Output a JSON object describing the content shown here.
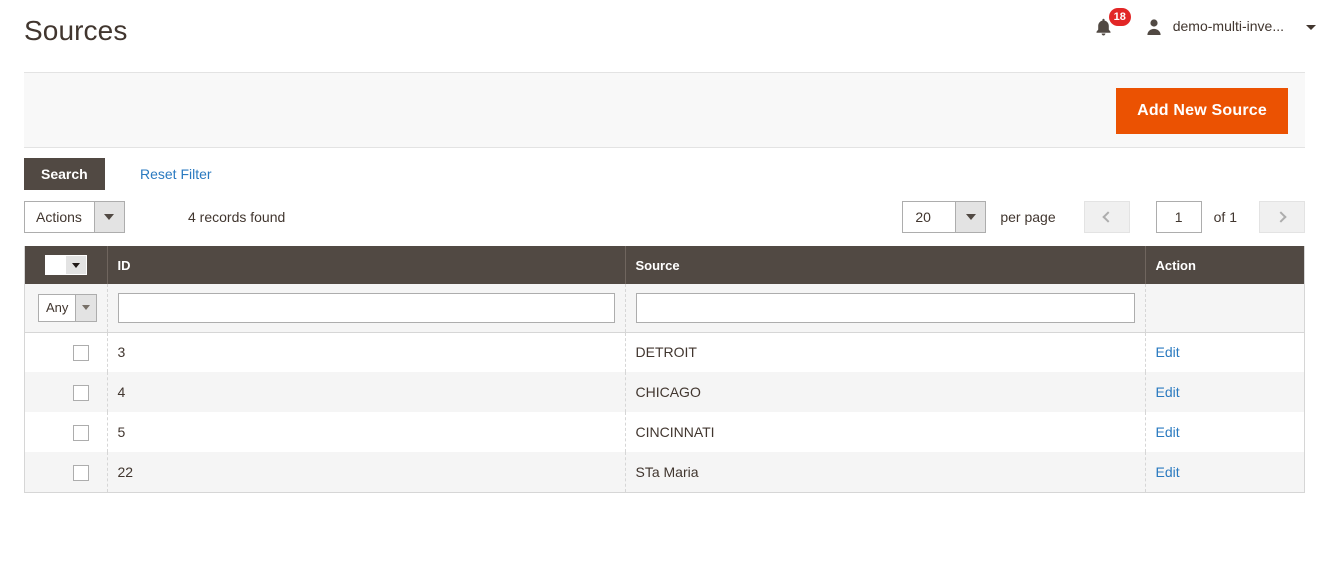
{
  "header": {
    "title": "Sources",
    "notifications": {
      "icon": "bell-icon",
      "count": "18"
    },
    "user": {
      "icon": "user-icon",
      "name": "demo-multi-inve...",
      "caret": "chevron-down-icon"
    }
  },
  "page_actions": {
    "add_new_source": "Add New Source",
    "accent_color": "#eb5202"
  },
  "grid_toolbar": {
    "search_button": "Search",
    "reset_filter": "Reset Filter",
    "actions_label": "Actions",
    "records_found": "4 records found",
    "per_page_value": "20",
    "per_page_label": "per page",
    "page_value": "1",
    "of_label": "of 1",
    "prev_icon": "chevron-left-icon",
    "next_icon": "chevron-right-icon"
  },
  "grid": {
    "columns": [
      {
        "key": "checkbox",
        "label": ""
      },
      {
        "key": "id",
        "label": "ID"
      },
      {
        "key": "source",
        "label": "Source"
      },
      {
        "key": "action",
        "label": "Action"
      }
    ],
    "filters": {
      "massaction_value": "Any",
      "id_value": "",
      "id_placeholder": "",
      "source_value": "",
      "source_placeholder": ""
    },
    "rows": [
      {
        "id": "3",
        "source": "DETROIT",
        "action": "Edit"
      },
      {
        "id": "4",
        "source": "CHICAGO",
        "action": "Edit"
      },
      {
        "id": "5",
        "source": "CINCINNATI",
        "action": "Edit"
      },
      {
        "id": "22",
        "source": "STa Maria",
        "action": "Edit"
      }
    ]
  }
}
